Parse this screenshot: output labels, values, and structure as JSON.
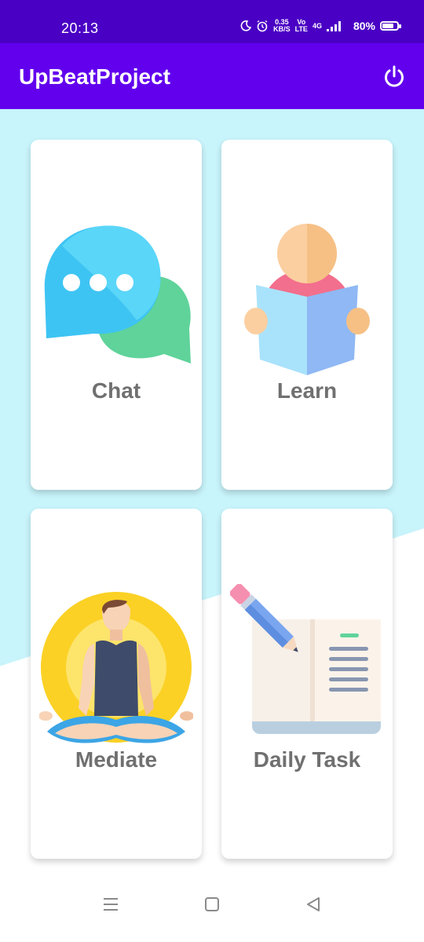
{
  "status_bar": {
    "time": "20:13",
    "data_speed_value": "0.35",
    "data_speed_unit": "KB/S",
    "volte_top": "Vo",
    "volte_bottom": "LTE",
    "network_type": "4G",
    "battery_percent": "80%",
    "battery_level": 0.8,
    "icons": [
      "moon-icon",
      "alarm-icon",
      "signal-icon"
    ]
  },
  "app_bar": {
    "title": "UpBeatProject",
    "power_icon": "power-icon"
  },
  "cards": [
    {
      "label": "Chat",
      "icon": "chat-bubbles-icon"
    },
    {
      "label": "Learn",
      "icon": "reading-person-icon"
    },
    {
      "label": "Mediate",
      "icon": "meditation-icon"
    },
    {
      "label": "Daily Task",
      "icon": "notebook-pencil-icon"
    }
  ],
  "colors": {
    "status_bar": "#4a00c4",
    "app_bar": "#6200ee",
    "background_cyan": "#c8f4fb",
    "label_gray": "#707070"
  },
  "nav_bar": {
    "icons": [
      "menu-icon",
      "home-icon",
      "back-icon"
    ]
  }
}
